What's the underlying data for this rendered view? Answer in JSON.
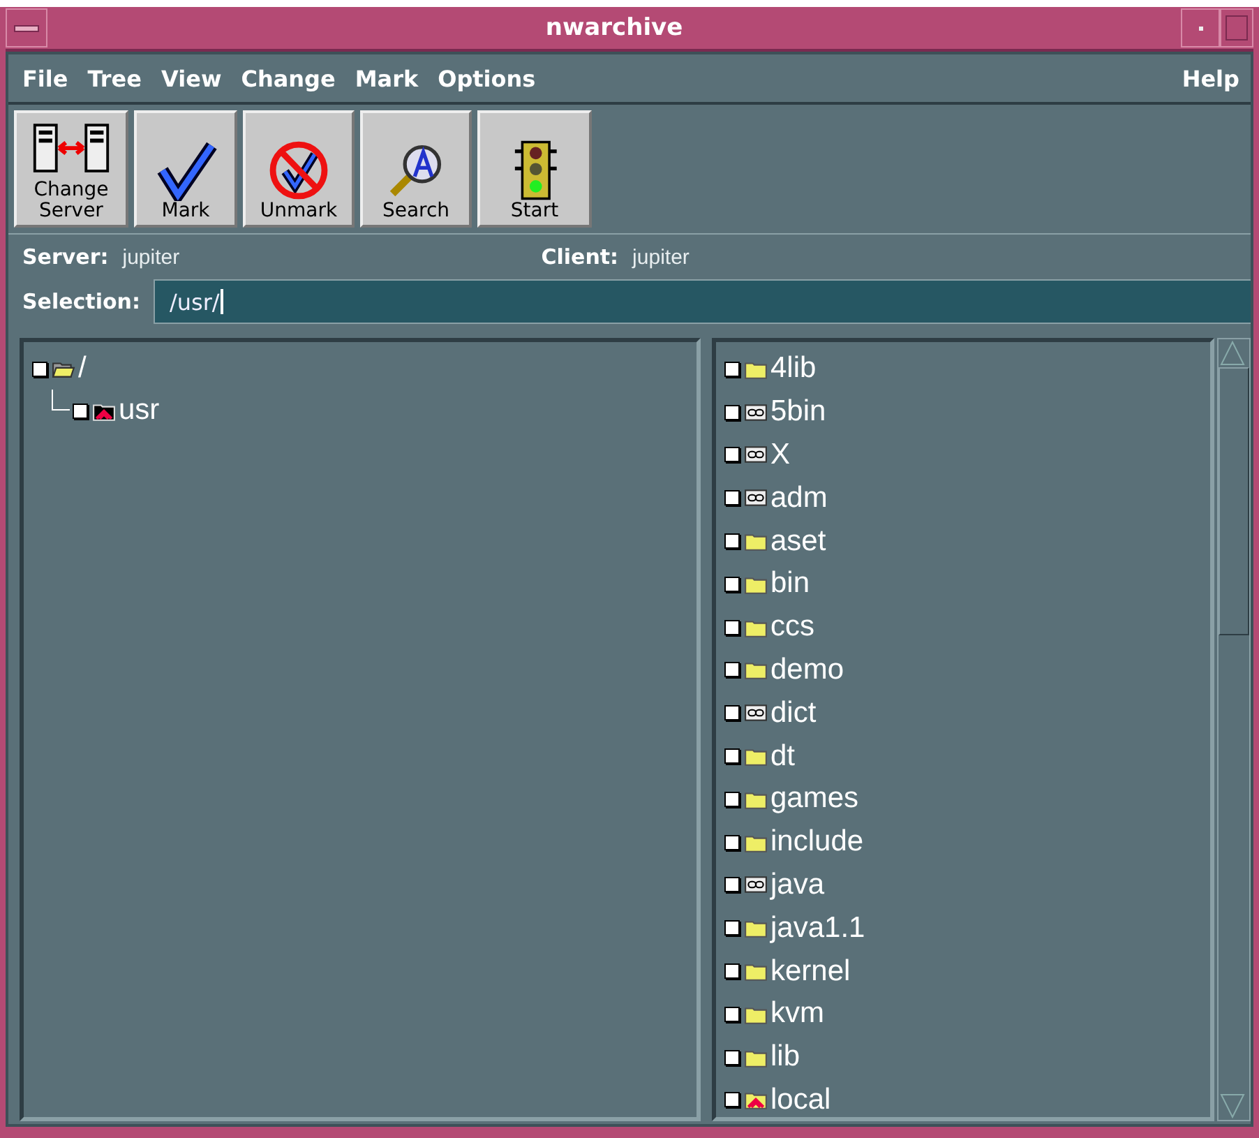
{
  "window": {
    "title": "nwarchive"
  },
  "menu": [
    {
      "label": "File"
    },
    {
      "label": "Tree"
    },
    {
      "label": "View"
    },
    {
      "label": "Change"
    },
    {
      "label": "Mark"
    },
    {
      "label": "Options"
    }
  ],
  "help_menu": {
    "label": "Help"
  },
  "toolbar": [
    {
      "kind": "servers",
      "label": "Change\nServer"
    },
    {
      "kind": "mark",
      "label": "Mark"
    },
    {
      "kind": "unmark",
      "label": "Unmark"
    },
    {
      "kind": "search",
      "label": "Search"
    },
    {
      "kind": "start",
      "label": "Start"
    }
  ],
  "server": {
    "label": "Server:",
    "value": "jupiter"
  },
  "client": {
    "label": "Client:",
    "value": "jupiter"
  },
  "selection": {
    "label": "Selection:",
    "value": "/usr/"
  },
  "tree": [
    {
      "name": "/",
      "kind": "open-folder",
      "marked": false,
      "children": [
        {
          "name": "usr",
          "kind": "restricted",
          "marked": false
        }
      ]
    }
  ],
  "files": [
    {
      "name": "4lib",
      "kind": "folder",
      "marked": false
    },
    {
      "name": "5bin",
      "kind": "link",
      "marked": false
    },
    {
      "name": "X",
      "kind": "link",
      "marked": false
    },
    {
      "name": "adm",
      "kind": "link",
      "marked": false
    },
    {
      "name": "aset",
      "kind": "folder",
      "marked": false
    },
    {
      "name": "bin",
      "kind": "folder",
      "marked": false
    },
    {
      "name": "ccs",
      "kind": "folder",
      "marked": false
    },
    {
      "name": "demo",
      "kind": "folder",
      "marked": false
    },
    {
      "name": "dict",
      "kind": "link",
      "marked": false
    },
    {
      "name": "dt",
      "kind": "folder",
      "marked": false
    },
    {
      "name": "games",
      "kind": "folder",
      "marked": false
    },
    {
      "name": "include",
      "kind": "folder",
      "marked": false
    },
    {
      "name": "java",
      "kind": "link",
      "marked": false
    },
    {
      "name": "java1.1",
      "kind": "folder",
      "marked": false
    },
    {
      "name": "kernel",
      "kind": "folder",
      "marked": false
    },
    {
      "name": "kvm",
      "kind": "folder",
      "marked": false
    },
    {
      "name": "lib",
      "kind": "folder",
      "marked": false
    },
    {
      "name": "local",
      "kind": "restricted",
      "marked": false
    }
  ]
}
